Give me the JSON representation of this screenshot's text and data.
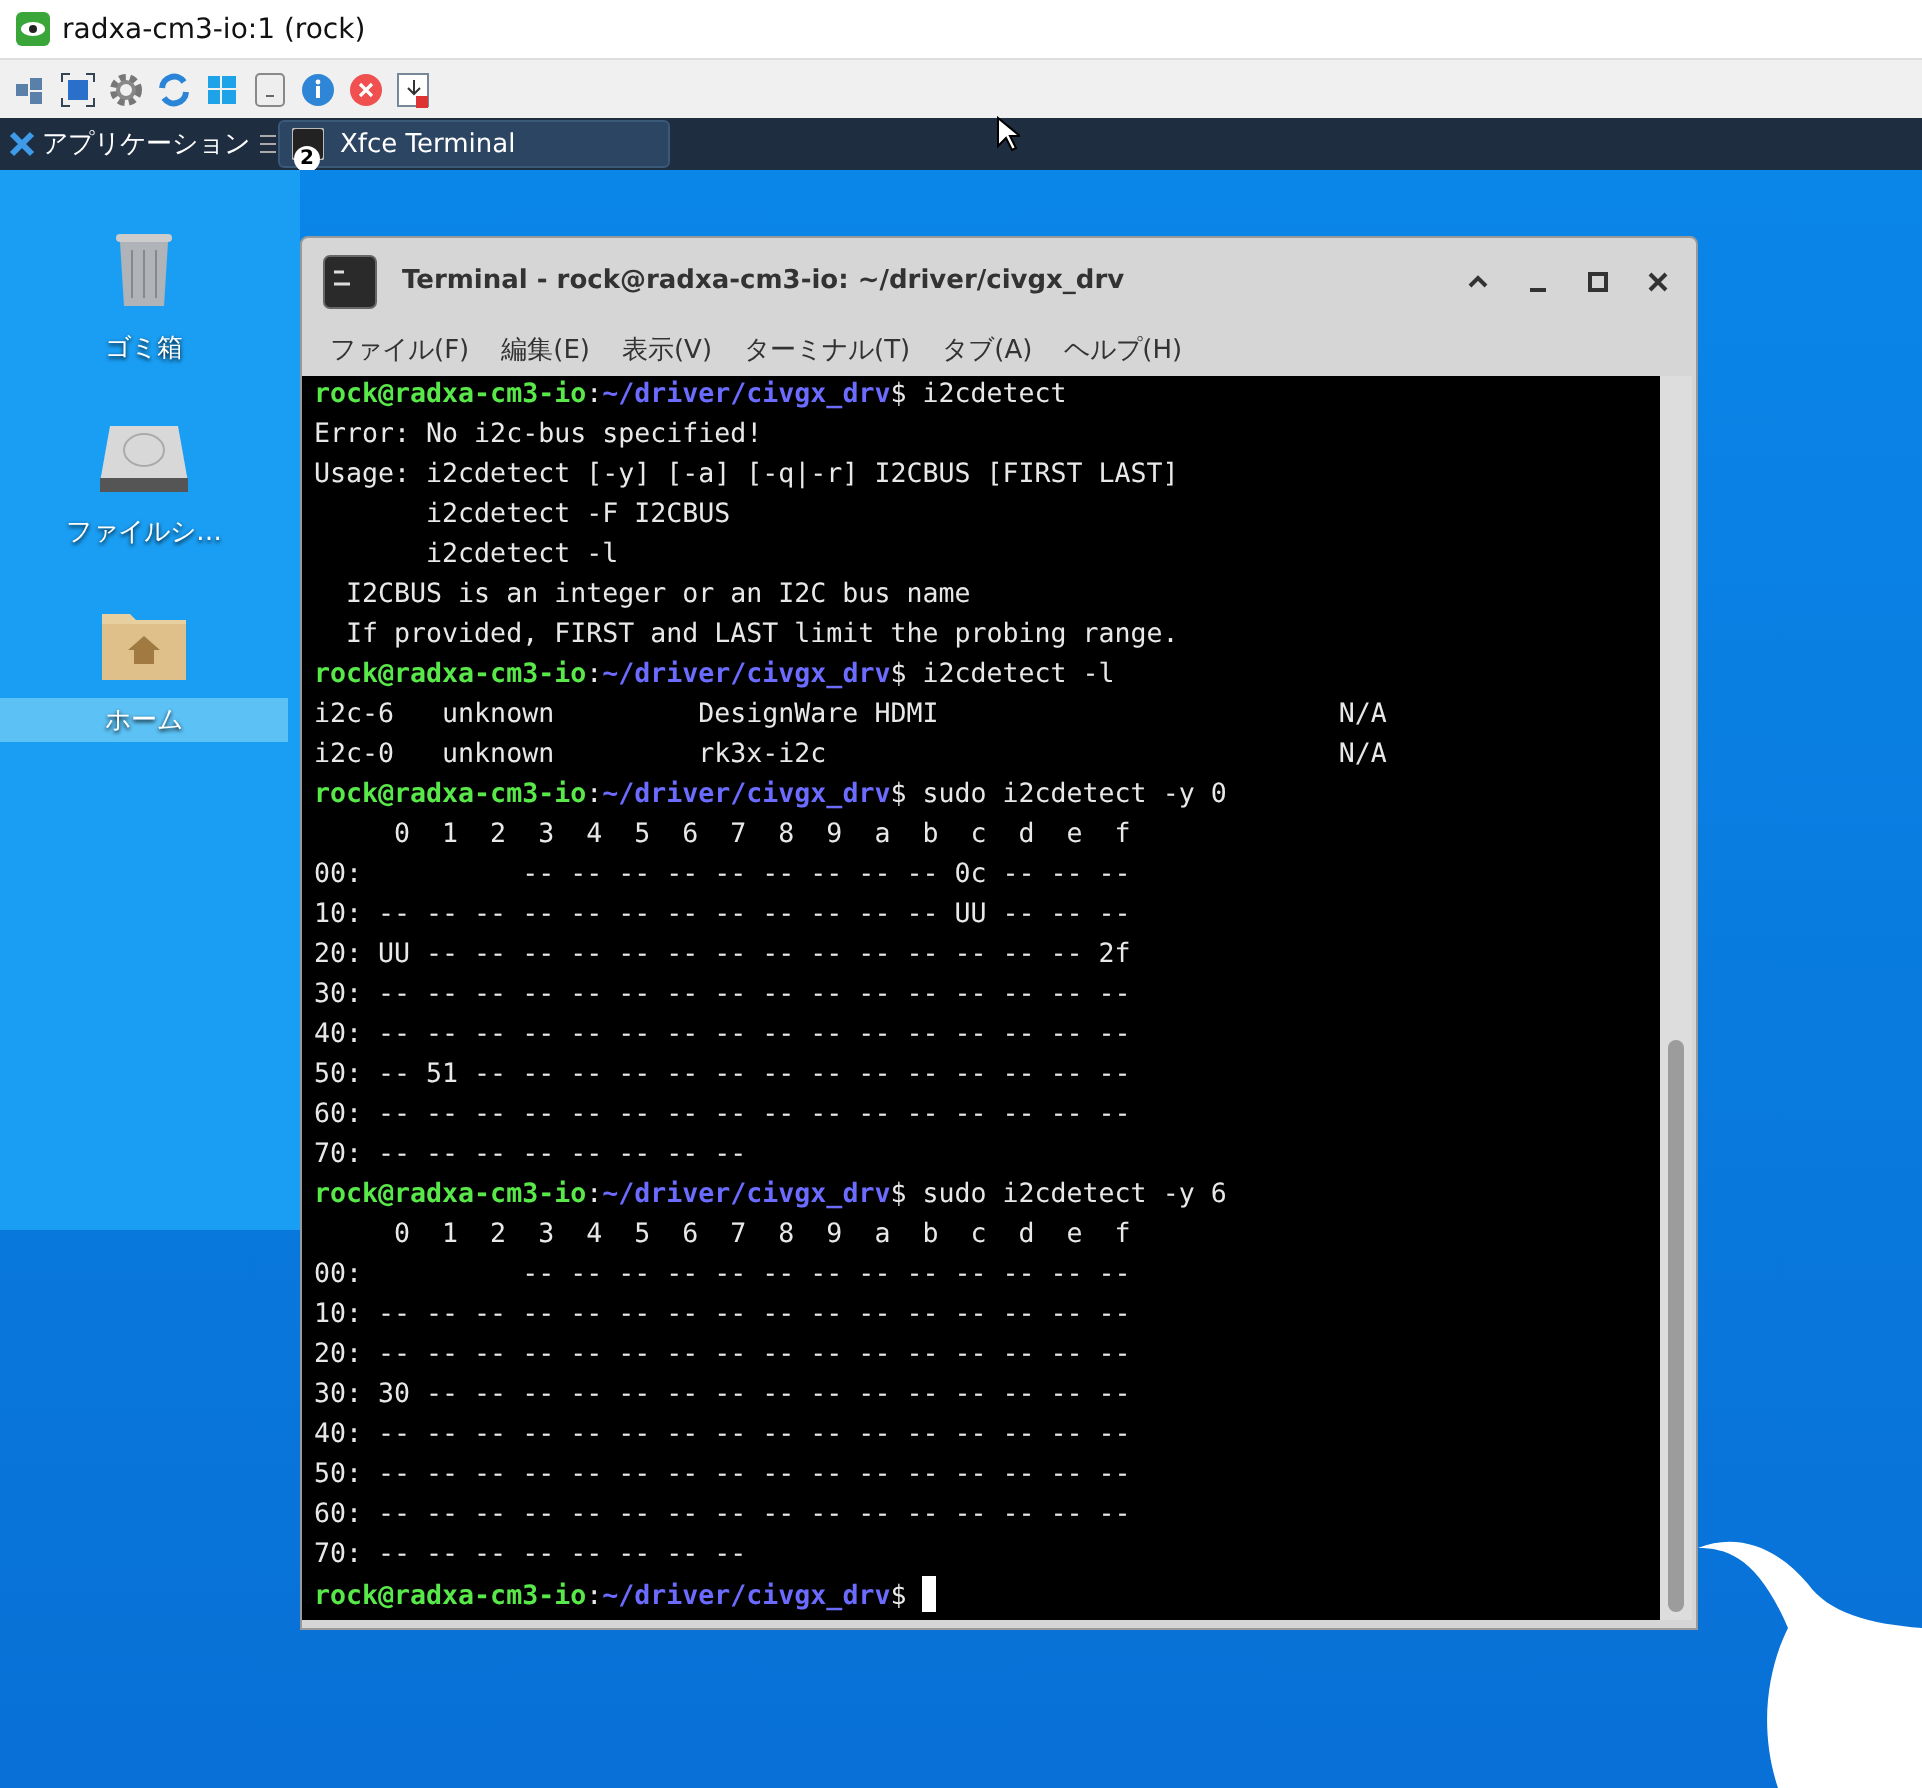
{
  "app_window": {
    "title": "radxa-cm3-io:1 (rock)"
  },
  "taskbar": {
    "menu_label": "アプリケーション",
    "tasks": [
      {
        "label": "Xfce Terminal",
        "badge": "2",
        "selected": true
      }
    ]
  },
  "desktop_icons": [
    {
      "kind": "trash",
      "label": "ゴミ箱",
      "selected": false
    },
    {
      "kind": "drive",
      "label": "ファイルシ…",
      "selected": false
    },
    {
      "kind": "home",
      "label": "ホーム",
      "selected": true
    }
  ],
  "terminal": {
    "title": "Terminal - rock@radxa-cm3-io: ~/driver/civgx_drv",
    "menu": [
      "ファイル(F)",
      "編集(E)",
      "表示(V)",
      "ターミナル(T)",
      "タブ(A)",
      "ヘルプ(H)"
    ],
    "lines": [
      {
        "kind": "prompt",
        "host": "rock@radxa-cm3-io",
        "sep": ":",
        "path": "~/driver/civgx_drv",
        "end": "$",
        "command": "i2cdetect"
      },
      {
        "kind": "output",
        "text": "Error: No i2c-bus specified!"
      },
      {
        "kind": "output",
        "text": "Usage: i2cdetect [-y] [-a] [-q|-r] I2CBUS [FIRST LAST]"
      },
      {
        "kind": "output",
        "text": "       i2cdetect -F I2CBUS"
      },
      {
        "kind": "output",
        "text": "       i2cdetect -l"
      },
      {
        "kind": "output",
        "text": "  I2CBUS is an integer or an I2C bus name"
      },
      {
        "kind": "output",
        "text": "  If provided, FIRST and LAST limit the probing range."
      },
      {
        "kind": "prompt",
        "host": "rock@radxa-cm3-io",
        "sep": ":",
        "path": "~/driver/civgx_drv",
        "end": "$",
        "command": "i2cdetect -l"
      },
      {
        "kind": "output",
        "text": "i2c-6   unknown         DesignWare HDMI                         N/A"
      },
      {
        "kind": "output",
        "text": "i2c-0   unknown         rk3x-i2c                                N/A"
      },
      {
        "kind": "prompt",
        "host": "rock@radxa-cm3-io",
        "sep": ":",
        "path": "~/driver/civgx_drv",
        "end": "$",
        "command": "sudo i2cdetect -y 0"
      },
      {
        "kind": "output",
        "text": "     0  1  2  3  4  5  6  7  8  9  a  b  c  d  e  f"
      },
      {
        "kind": "output",
        "text": "00:          -- -- -- -- -- -- -- -- -- 0c -- -- --"
      },
      {
        "kind": "output",
        "text": "10: -- -- -- -- -- -- -- -- -- -- -- -- UU -- -- --"
      },
      {
        "kind": "output",
        "text": "20: UU -- -- -- -- -- -- -- -- -- -- -- -- -- -- 2f"
      },
      {
        "kind": "output",
        "text": "30: -- -- -- -- -- -- -- -- -- -- -- -- -- -- -- --"
      },
      {
        "kind": "output",
        "text": "40: -- -- -- -- -- -- -- -- -- -- -- -- -- -- -- --"
      },
      {
        "kind": "output",
        "text": "50: -- 51 -- -- -- -- -- -- -- -- -- -- -- -- -- --"
      },
      {
        "kind": "output",
        "text": "60: -- -- -- -- -- -- -- -- -- -- -- -- -- -- -- --"
      },
      {
        "kind": "output",
        "text": "70: -- -- -- -- -- -- -- --"
      },
      {
        "kind": "prompt",
        "host": "rock@radxa-cm3-io",
        "sep": ":",
        "path": "~/driver/civgx_drv",
        "end": "$",
        "command": "sudo i2cdetect -y 6"
      },
      {
        "kind": "output",
        "text": "     0  1  2  3  4  5  6  7  8  9  a  b  c  d  e  f"
      },
      {
        "kind": "output",
        "text": "00:          -- -- -- -- -- -- -- -- -- -- -- -- --"
      },
      {
        "kind": "output",
        "text": "10: -- -- -- -- -- -- -- -- -- -- -- -- -- -- -- --"
      },
      {
        "kind": "output",
        "text": "20: -- -- -- -- -- -- -- -- -- -- -- -- -- -- -- --"
      },
      {
        "kind": "output",
        "text": "30: 30 -- -- -- -- -- -- -- -- -- -- -- -- -- -- --"
      },
      {
        "kind": "output",
        "text": "40: -- -- -- -- -- -- -- -- -- -- -- -- -- -- -- --"
      },
      {
        "kind": "output",
        "text": "50: -- -- -- -- -- -- -- -- -- -- -- -- -- -- -- --"
      },
      {
        "kind": "output",
        "text": "60: -- -- -- -- -- -- -- -- -- -- -- -- -- -- -- --"
      },
      {
        "kind": "output",
        "text": "70: -- -- -- -- -- -- -- --"
      },
      {
        "kind": "prompt",
        "host": "rock@radxa-cm3-io",
        "sep": ":",
        "path": "~/driver/civgx_drv",
        "end": "$",
        "cursor": true
      }
    ]
  }
}
